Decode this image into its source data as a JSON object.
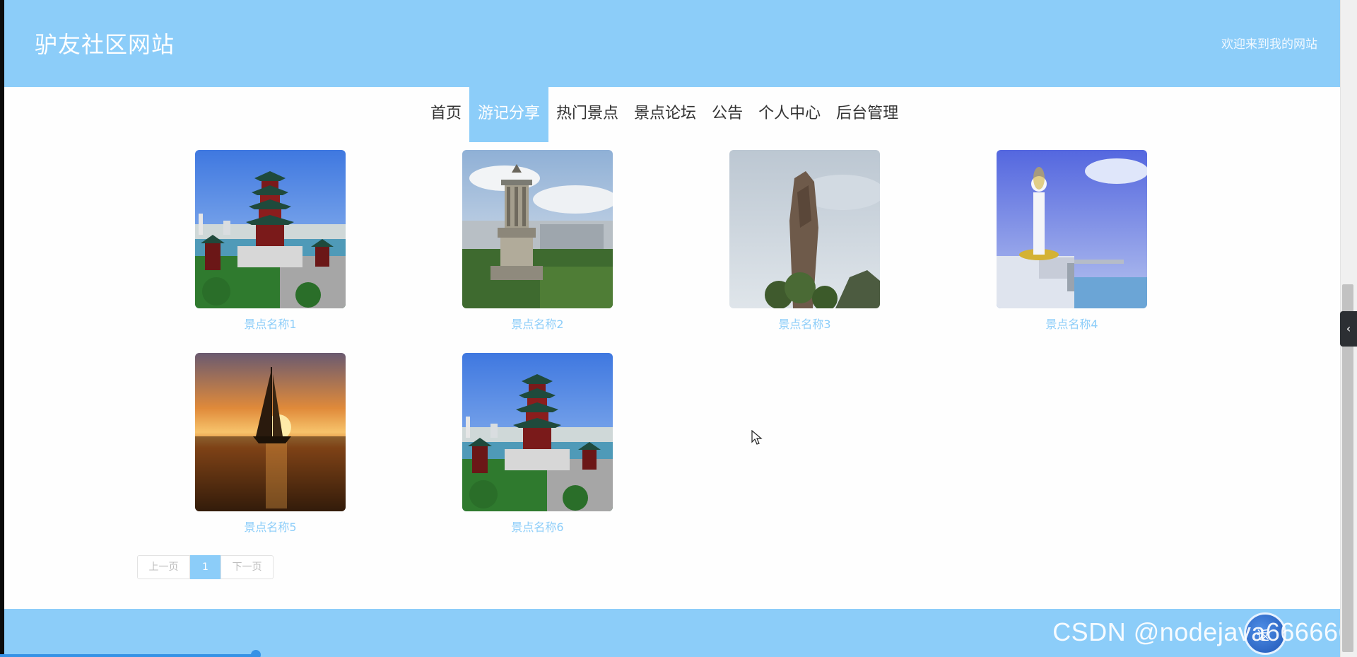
{
  "header": {
    "site_title": "驴友社区网站",
    "welcome": "欢迎来到我的网站"
  },
  "nav": {
    "items": [
      {
        "label": "首页"
      },
      {
        "label": "游记分享",
        "active": true
      },
      {
        "label": "热门景点"
      },
      {
        "label": "景点论坛"
      },
      {
        "label": "公告"
      },
      {
        "label": "个人中心"
      },
      {
        "label": "后台管理"
      }
    ]
  },
  "cards": [
    {
      "caption": "景点名称1",
      "image": "pagoda-icon"
    },
    {
      "caption": "景点名称2",
      "image": "monument-icon"
    },
    {
      "caption": "景点名称3",
      "image": "rock-pillar-icon"
    },
    {
      "caption": "景点名称4",
      "image": "statue-icon"
    },
    {
      "caption": "景点名称5",
      "image": "sailboat-icon"
    },
    {
      "caption": "景点名称6",
      "image": "pagoda-icon"
    }
  ],
  "pagination": {
    "prev": "上一页",
    "current": "1",
    "next": "下一页"
  },
  "footer": {
    "watermark": "CSDN @nodejava666666",
    "avatar_text": "返"
  },
  "colors": {
    "accent": "#8ccdf9",
    "nav_text": "#333333"
  },
  "side_toggle_icon": "chevron-left-icon"
}
